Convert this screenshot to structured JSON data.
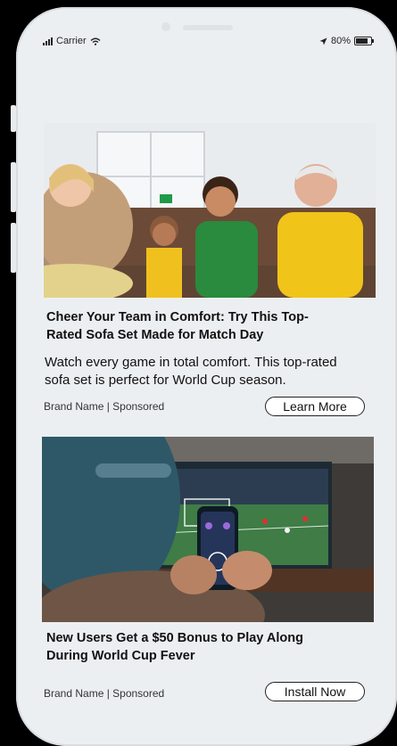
{
  "status_bar": {
    "carrier": "Carrier",
    "wifi_icon": "wifi-icon",
    "location_icon": "location-arrow-icon",
    "battery_text": "80%",
    "battery_level": 0.8
  },
  "ads": [
    {
      "image": "family-watching-match-on-sofa",
      "title": "Cheer Your Team in Comfort: Try This Top-Rated Sofa Set Made for Match Day",
      "body": "Watch every game in total comfort. This top-rated sofa set is perfect for World Cup season.",
      "meta": "Brand Name | Sponsored",
      "cta": "Learn More"
    },
    {
      "image": "man-holding-phone-betting-app-in-front-of-tv",
      "title": "New Users Get a $50 Bonus to Play Along During World Cup Fever",
      "meta": "Brand Name | Sponsored",
      "cta": "Install Now"
    }
  ],
  "colors": {
    "frame": "#eceff2",
    "screen": "#ffffff",
    "text": "#111111"
  }
}
